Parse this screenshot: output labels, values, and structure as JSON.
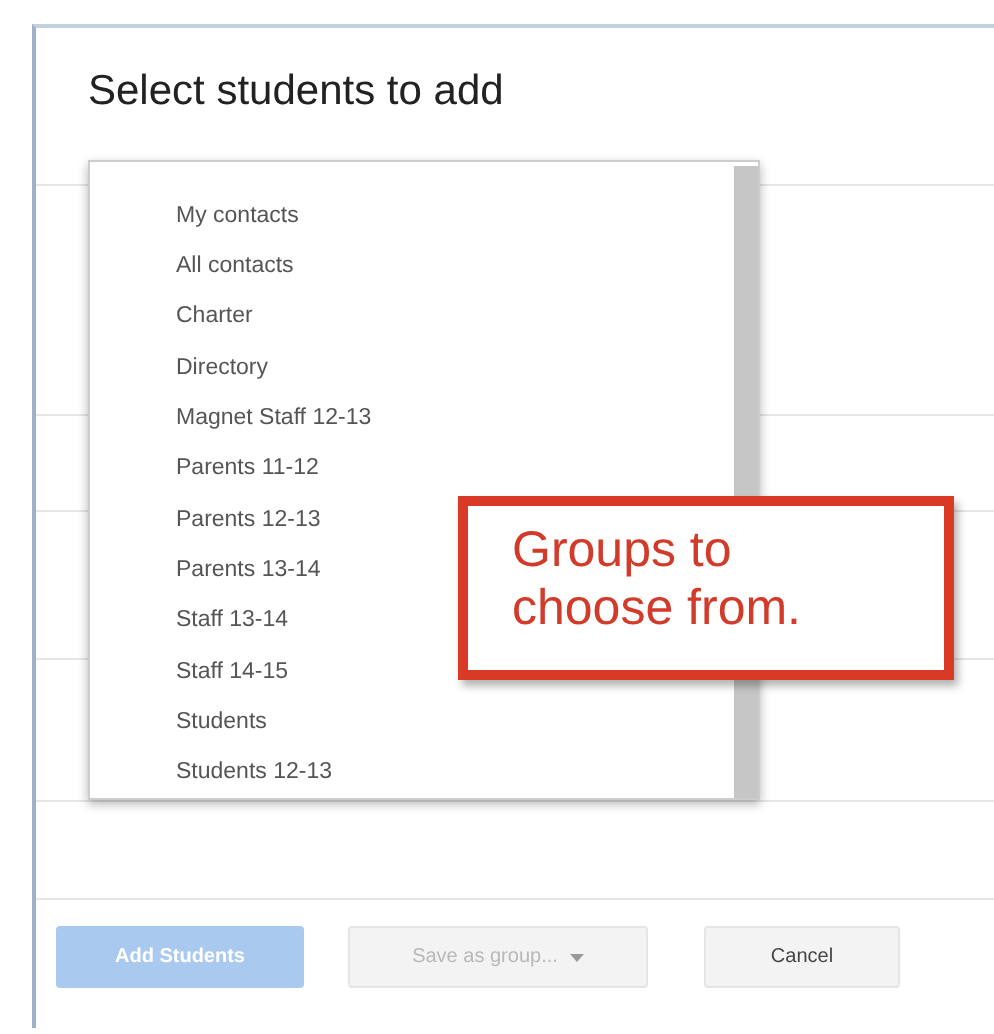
{
  "dialog": {
    "title": "Select students to add"
  },
  "group_list": {
    "items": [
      {
        "label": "My contacts"
      },
      {
        "label": "All contacts"
      },
      {
        "label": "Charter"
      },
      {
        "label": "Directory"
      },
      {
        "label": "Magnet Staff 12-13"
      },
      {
        "label": "Parents 11-12"
      },
      {
        "label": "Parents 12-13"
      },
      {
        "label": "Parents 13-14"
      },
      {
        "label": "Staff 13-14"
      },
      {
        "label": "Staff 14-15"
      },
      {
        "label": "Students"
      },
      {
        "label": "Students 12-13"
      }
    ]
  },
  "callout": {
    "text": "Groups to choose from."
  },
  "buttons": [
    {
      "label": "Add Students",
      "kind": "primary",
      "disabled": true
    },
    {
      "label": "Save as group...",
      "kind": "menu",
      "disabled": true
    },
    {
      "label": "Cancel",
      "kind": "plain",
      "disabled": false
    }
  ]
}
